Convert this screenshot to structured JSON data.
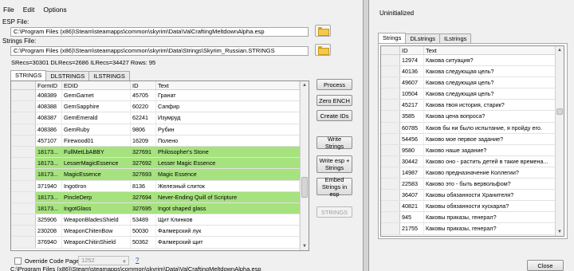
{
  "menu": [
    "File",
    "Edit",
    "Options"
  ],
  "esp": {
    "label": "ESP File:",
    "path": "C:\\Program Files (x86)\\Steam\\steamapps\\common\\skyrim\\Data\\ValCraftingMeltdownAlpha.esp"
  },
  "strings_file": {
    "label": "Strings File:",
    "path": "C:\\Program Files (x86)\\Steam\\steamapps\\common\\skyrim\\Data\\Strings\\Skyrim_Russian.STRINGS"
  },
  "stats": "SRecs=30301  DLRecs=2686  ILRecs=34427   Rows: 95",
  "left_tabs": [
    "STRINGS",
    "DLSTRINGS",
    "ILSTRINGS"
  ],
  "left_grid": {
    "columns": [
      "FormID",
      "EDID",
      "ID",
      "Text"
    ],
    "rows": [
      {
        "formid": "408389",
        "edid": "GemGarnet",
        "id": "45705",
        "text": "Гранат",
        "green": false
      },
      {
        "formid": "408388",
        "edid": "GemSapphire",
        "id": "60220",
        "text": "Сапфир",
        "green": false
      },
      {
        "formid": "408387",
        "edid": "GemEmerald",
        "id": "62241",
        "text": "Изумруд",
        "green": false
      },
      {
        "formid": "408386",
        "edid": "GemRuby",
        "id": "9806",
        "text": "Рубин",
        "green": false
      },
      {
        "formid": "457107",
        "edid": "Firewood01",
        "id": "16209",
        "text": "Полено",
        "green": false
      },
      {
        "formid": "18173...",
        "edid": "FullMetLbABBY",
        "id": "327691",
        "text": "Philosopher's Stone",
        "green": true
      },
      {
        "formid": "18173...",
        "edid": "LesserMagicEssence",
        "id": "327692",
        "text": "Lesser Magic Essence",
        "green": true
      },
      {
        "formid": "18173...",
        "edid": "MagicEssence",
        "id": "327693",
        "text": "Magic Essence",
        "green": true
      },
      {
        "formid": "371940",
        "edid": "IngotIron",
        "id": "8136",
        "text": "Железный слиток",
        "green": false
      },
      {
        "formid": "18173...",
        "edid": "PincleDerp",
        "id": "327694",
        "text": "Never-Ending Quill of Scripture",
        "green": true
      },
      {
        "formid": "18173...",
        "edid": "IngotGlass",
        "id": "327695",
        "text": "Ingot shaped glass",
        "green": true
      },
      {
        "formid": "325906",
        "edid": "WeaponBladesShield",
        "id": "53489",
        "text": "Щит Клинков",
        "green": false
      },
      {
        "formid": "230208",
        "edid": "WeaponChitenBow",
        "id": "50030",
        "text": "Фалмерский лук",
        "green": false
      },
      {
        "formid": "376940",
        "edid": "WeaponChitinShield",
        "id": "50362",
        "text": "Фалмерский щит",
        "green": false
      }
    ]
  },
  "buttons": {
    "process": "Process",
    "zero_ench": "Zero ENCH",
    "create_ids": "Create IDs",
    "write_strings": "Write Strings",
    "write_esp_strings": "Write esp + Strings",
    "embed_strings": "Embed Strings in esp",
    "strings_disabled": "STRINGS"
  },
  "override": {
    "label": "Override Code Page:",
    "value": "1252",
    "help": "?"
  },
  "bottom_path": "C:\\Program Files (x86)\\Steam\\steamapps\\common\\skyrim\\Data\\ValCraftingMeltdownAlpha.esp",
  "right": {
    "status": "Uninitialized",
    "tabs": [
      "Strings",
      "DLstrings",
      "ILstrings"
    ],
    "columns": [
      "ID",
      "Text"
    ],
    "rows": [
      {
        "id": "12974",
        "text": "Какова ситуация?"
      },
      {
        "id": "40136",
        "text": "Какова следующая цель?"
      },
      {
        "id": "49607",
        "text": "Какова следующая цель?"
      },
      {
        "id": "10504",
        "text": "Какова следующая цель?"
      },
      {
        "id": "45217",
        "text": "Какова твоя история, старик?"
      },
      {
        "id": "3585",
        "text": "Какова цена вопроса?"
      },
      {
        "id": "60785",
        "text": "Каков бы ни было испытание, я пройду его."
      },
      {
        "id": "54456",
        "text": "Каково мое первое задание?"
      },
      {
        "id": "9580",
        "text": "Каково наше задание?"
      },
      {
        "id": "30442",
        "text": "Каково оно - растить детей в такие времена..."
      },
      {
        "id": "14987",
        "text": "Каково предназначение Коллегии?"
      },
      {
        "id": "22583",
        "text": "Каково это - быть вервольфом?"
      },
      {
        "id": "36407",
        "text": "Каковы обязанности Хранителя?"
      },
      {
        "id": "40821",
        "text": "Каковы обязанности хускарла?"
      },
      {
        "id": "945",
        "text": "Каковы приказы, генерал?"
      },
      {
        "id": "21755",
        "text": "Каковы приказы, генерал?"
      }
    ],
    "close": "Close"
  }
}
